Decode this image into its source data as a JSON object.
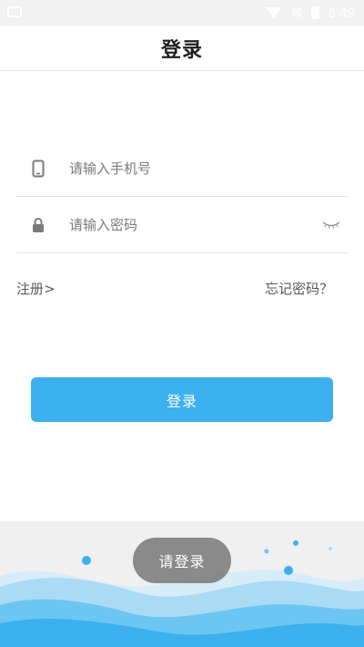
{
  "status_bar": {
    "time": "8:49"
  },
  "header": {
    "title": "登录"
  },
  "form": {
    "phone": {
      "placeholder": "请输入手机号",
      "icon": "phone-icon"
    },
    "password": {
      "placeholder": "请输入密码",
      "icon": "lock-icon",
      "toggle_icon": "eye-closed-icon"
    },
    "register_link": "注册>",
    "forgot_link": "忘记密码？",
    "submit_label": "登录"
  },
  "toast": {
    "text": "请登录"
  },
  "colors": {
    "accent": "#3db0ee",
    "wave_light": "#bfe3f7",
    "wave_mid": "#7fcaf1",
    "wave_dark": "#3db0ee"
  }
}
